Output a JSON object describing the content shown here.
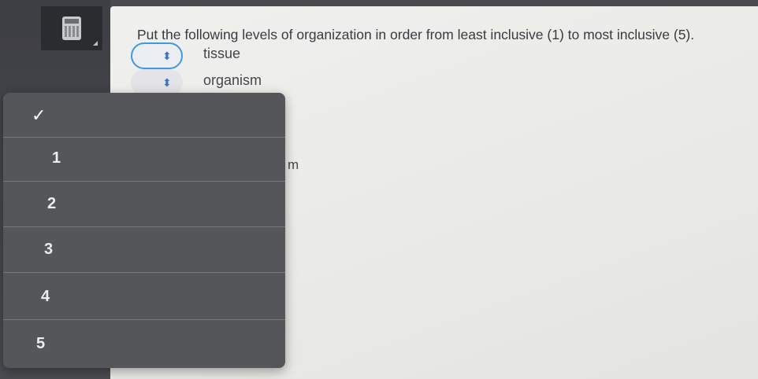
{
  "question": {
    "prompt": "Put the following levels of organization in order from least inclusive (1) to most inclusive (5).",
    "items": [
      {
        "label": "tissue"
      },
      {
        "label": "organism"
      }
    ],
    "partially_hidden_text": "m"
  },
  "dropdown": {
    "selected_mark": "✓",
    "options": [
      "1",
      "2",
      "3",
      "4",
      "5"
    ]
  },
  "icons": {
    "toolbar": "calculator-icon",
    "select": "chevron-up-down-icon",
    "check": "checkmark-icon"
  },
  "colors": {
    "focus_ring": "#3b9ae4",
    "chevron": "#3a76c4",
    "dropdown_bg": "#55565a"
  }
}
